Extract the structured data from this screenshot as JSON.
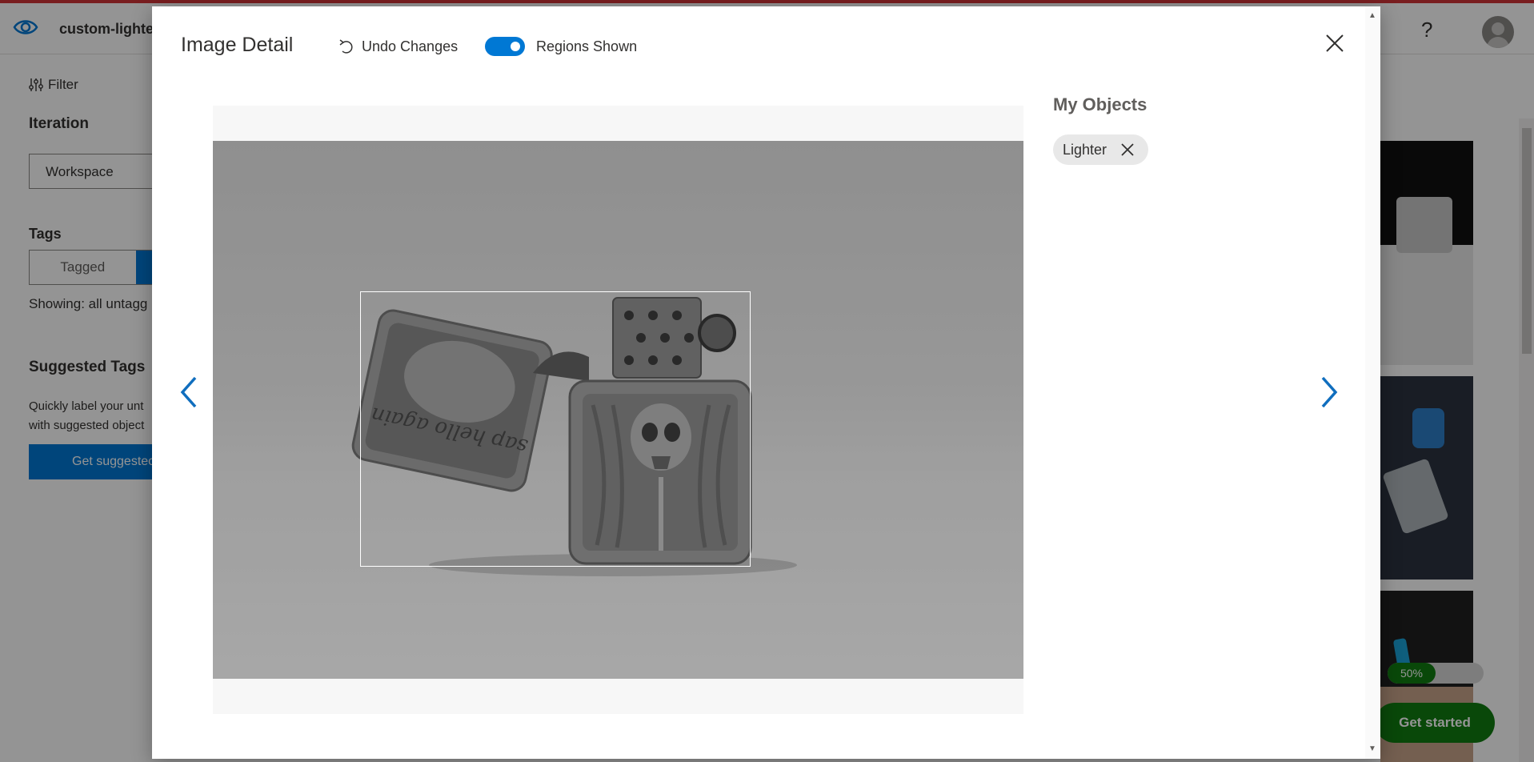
{
  "app": {
    "project_name": "custom-lighter",
    "accent_color": "#0078d4",
    "header_icons": [
      "eye-icon",
      "help-icon",
      "avatar"
    ],
    "help_label": "?"
  },
  "sidebar": {
    "filter_label": "Filter",
    "iteration_heading": "Iteration",
    "iteration_value": "Workspace",
    "tags_heading": "Tags",
    "tags_tab_tagged": "Tagged",
    "showing_text": "Showing: all untagg",
    "suggested_heading": "Suggested Tags",
    "suggested_text": "Quickly label your unt with suggested object",
    "suggested_button": "Get suggestec"
  },
  "footer": {
    "progress_label": "50%",
    "progress_value": 0.5,
    "get_started_label": "Get started"
  },
  "modal": {
    "title": "Image Detail",
    "undo_label": "Undo Changes",
    "toggle_label": "Regions Shown",
    "toggle_on": true,
    "objects_heading": "My Objects",
    "objects": [
      {
        "label": "Lighter"
      }
    ],
    "image_text": "sap hello again"
  }
}
